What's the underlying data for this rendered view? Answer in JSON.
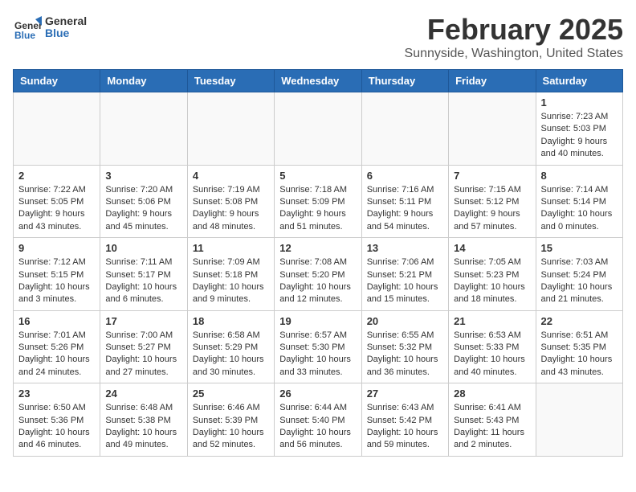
{
  "header": {
    "logo_general": "General",
    "logo_blue": "Blue",
    "title": "February 2025",
    "location": "Sunnyside, Washington, United States"
  },
  "weekdays": [
    "Sunday",
    "Monday",
    "Tuesday",
    "Wednesday",
    "Thursday",
    "Friday",
    "Saturday"
  ],
  "weeks": [
    [
      {
        "day": "",
        "info": ""
      },
      {
        "day": "",
        "info": ""
      },
      {
        "day": "",
        "info": ""
      },
      {
        "day": "",
        "info": ""
      },
      {
        "day": "",
        "info": ""
      },
      {
        "day": "",
        "info": ""
      },
      {
        "day": "1",
        "info": "Sunrise: 7:23 AM\nSunset: 5:03 PM\nDaylight: 9 hours and 40 minutes."
      }
    ],
    [
      {
        "day": "2",
        "info": "Sunrise: 7:22 AM\nSunset: 5:05 PM\nDaylight: 9 hours and 43 minutes."
      },
      {
        "day": "3",
        "info": "Sunrise: 7:20 AM\nSunset: 5:06 PM\nDaylight: 9 hours and 45 minutes."
      },
      {
        "day": "4",
        "info": "Sunrise: 7:19 AM\nSunset: 5:08 PM\nDaylight: 9 hours and 48 minutes."
      },
      {
        "day": "5",
        "info": "Sunrise: 7:18 AM\nSunset: 5:09 PM\nDaylight: 9 hours and 51 minutes."
      },
      {
        "day": "6",
        "info": "Sunrise: 7:16 AM\nSunset: 5:11 PM\nDaylight: 9 hours and 54 minutes."
      },
      {
        "day": "7",
        "info": "Sunrise: 7:15 AM\nSunset: 5:12 PM\nDaylight: 9 hours and 57 minutes."
      },
      {
        "day": "8",
        "info": "Sunrise: 7:14 AM\nSunset: 5:14 PM\nDaylight: 10 hours and 0 minutes."
      }
    ],
    [
      {
        "day": "9",
        "info": "Sunrise: 7:12 AM\nSunset: 5:15 PM\nDaylight: 10 hours and 3 minutes."
      },
      {
        "day": "10",
        "info": "Sunrise: 7:11 AM\nSunset: 5:17 PM\nDaylight: 10 hours and 6 minutes."
      },
      {
        "day": "11",
        "info": "Sunrise: 7:09 AM\nSunset: 5:18 PM\nDaylight: 10 hours and 9 minutes."
      },
      {
        "day": "12",
        "info": "Sunrise: 7:08 AM\nSunset: 5:20 PM\nDaylight: 10 hours and 12 minutes."
      },
      {
        "day": "13",
        "info": "Sunrise: 7:06 AM\nSunset: 5:21 PM\nDaylight: 10 hours and 15 minutes."
      },
      {
        "day": "14",
        "info": "Sunrise: 7:05 AM\nSunset: 5:23 PM\nDaylight: 10 hours and 18 minutes."
      },
      {
        "day": "15",
        "info": "Sunrise: 7:03 AM\nSunset: 5:24 PM\nDaylight: 10 hours and 21 minutes."
      }
    ],
    [
      {
        "day": "16",
        "info": "Sunrise: 7:01 AM\nSunset: 5:26 PM\nDaylight: 10 hours and 24 minutes."
      },
      {
        "day": "17",
        "info": "Sunrise: 7:00 AM\nSunset: 5:27 PM\nDaylight: 10 hours and 27 minutes."
      },
      {
        "day": "18",
        "info": "Sunrise: 6:58 AM\nSunset: 5:29 PM\nDaylight: 10 hours and 30 minutes."
      },
      {
        "day": "19",
        "info": "Sunrise: 6:57 AM\nSunset: 5:30 PM\nDaylight: 10 hours and 33 minutes."
      },
      {
        "day": "20",
        "info": "Sunrise: 6:55 AM\nSunset: 5:32 PM\nDaylight: 10 hours and 36 minutes."
      },
      {
        "day": "21",
        "info": "Sunrise: 6:53 AM\nSunset: 5:33 PM\nDaylight: 10 hours and 40 minutes."
      },
      {
        "day": "22",
        "info": "Sunrise: 6:51 AM\nSunset: 5:35 PM\nDaylight: 10 hours and 43 minutes."
      }
    ],
    [
      {
        "day": "23",
        "info": "Sunrise: 6:50 AM\nSunset: 5:36 PM\nDaylight: 10 hours and 46 minutes."
      },
      {
        "day": "24",
        "info": "Sunrise: 6:48 AM\nSunset: 5:38 PM\nDaylight: 10 hours and 49 minutes."
      },
      {
        "day": "25",
        "info": "Sunrise: 6:46 AM\nSunset: 5:39 PM\nDaylight: 10 hours and 52 minutes."
      },
      {
        "day": "26",
        "info": "Sunrise: 6:44 AM\nSunset: 5:40 PM\nDaylight: 10 hours and 56 minutes."
      },
      {
        "day": "27",
        "info": "Sunrise: 6:43 AM\nSunset: 5:42 PM\nDaylight: 10 hours and 59 minutes."
      },
      {
        "day": "28",
        "info": "Sunrise: 6:41 AM\nSunset: 5:43 PM\nDaylight: 11 hours and 2 minutes."
      },
      {
        "day": "",
        "info": ""
      }
    ]
  ]
}
